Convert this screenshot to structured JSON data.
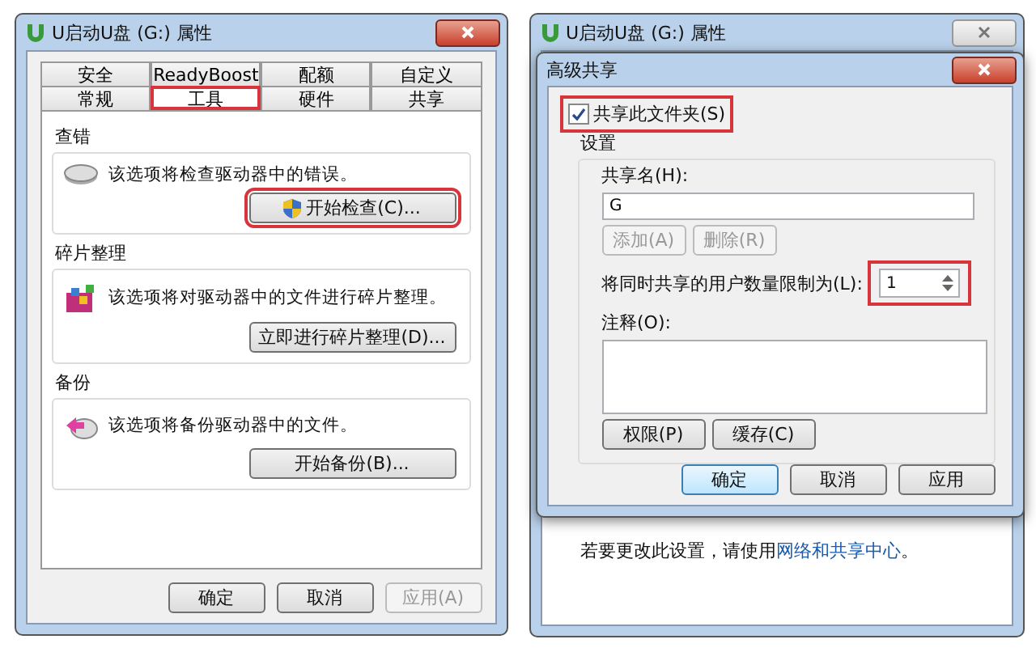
{
  "properties_window": {
    "title": "U启动U盘 (G:) 属性",
    "tabs_row_1": [
      {
        "label": "安全",
        "selected": false,
        "highlighted": false
      },
      {
        "label": "ReadyBoost",
        "selected": false,
        "highlighted": false
      },
      {
        "label": "配额",
        "selected": false,
        "highlighted": false
      },
      {
        "label": "自定义",
        "selected": false,
        "highlighted": false
      }
    ],
    "tabs_row_2": [
      {
        "label": "常规",
        "selected": false,
        "highlighted": false
      },
      {
        "label": "工具",
        "selected": true,
        "highlighted": true
      },
      {
        "label": "硬件",
        "selected": false,
        "highlighted": false
      },
      {
        "label": "共享",
        "selected": false,
        "highlighted": false
      }
    ],
    "groups": [
      {
        "kind": "check",
        "title": "查错",
        "description": "该选项将检查驱动器中的错误。",
        "button": {
          "label": "开始检查(C)...",
          "shield": true,
          "highlighted": true
        }
      },
      {
        "kind": "defrag",
        "title": "碎片整理",
        "description": "该选项将对驱动器中的文件进行碎片整理。",
        "button": {
          "label": "立即进行碎片整理(D)...",
          "shield": false,
          "highlighted": false
        }
      },
      {
        "kind": "backup",
        "title": "备份",
        "description": "该选项将备份驱动器中的文件。",
        "button": {
          "label": "开始备份(B)...",
          "shield": false,
          "highlighted": false
        }
      }
    ],
    "buttons": [
      {
        "label": "确定",
        "disabled": false
      },
      {
        "label": "取消",
        "disabled": false
      },
      {
        "label": "应用(A)",
        "disabled": true
      }
    ]
  },
  "sharing": {
    "back_title": "U启动U盘 (G:) 属性",
    "back_note_before": "若要更改此设置，请使用",
    "back_note_link": "网络和共享中心",
    "back_note_after": "。",
    "title": "高级共享",
    "share_checkbox": {
      "label": "共享此文件夹(S)",
      "checked": true,
      "highlighted": true
    },
    "settings_title": "设置",
    "share_name_label": "共享名(H):",
    "share_name_value": "G",
    "name_buttons": [
      {
        "label": "添加(A)",
        "disabled": true
      },
      {
        "label": "删除(R)",
        "disabled": true
      }
    ],
    "limit_label": "将同时共享的用户数量限制为(L):",
    "limit_value": "1",
    "limit_highlighted": true,
    "comment_label": "注释(O):",
    "extra_buttons": [
      {
        "label": "权限(P)"
      },
      {
        "label": "缓存(C)"
      }
    ],
    "dialog_buttons": [
      {
        "label": "确定",
        "default": true
      },
      {
        "label": "取消",
        "default": false
      },
      {
        "label": "应用",
        "default": false
      }
    ]
  }
}
